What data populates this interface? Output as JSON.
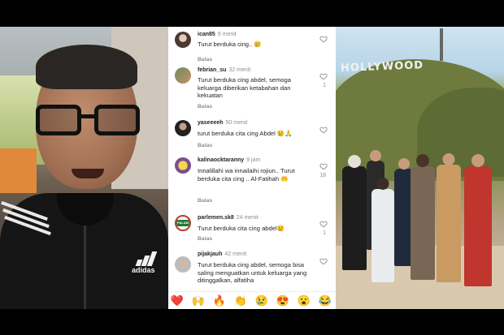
{
  "comments_panel": {
    "items": [
      {
        "username": "ican85",
        "time": "9 menit",
        "text": "Turut berduka cing.. 😢",
        "reply": "Balas",
        "likes": ""
      },
      {
        "username": "febrian_su",
        "time": "32 menit",
        "text": "Turut berduka cing abdel, semoga keluarga diberikan ketabahan dan kekuatan",
        "reply": "Balas",
        "likes": "1"
      },
      {
        "username": "yaseeeeh",
        "time": "50 menit",
        "text": "turut berduka cita cing Abdel 😢🙏",
        "reply": "Balas",
        "likes": ""
      },
      {
        "username": "kalinaocktaranny",
        "time": "9 jam",
        "text": "Innalillahi wa innailaihi rojiun.. Turut berduka cita cing .. Al-Fatihah 🤲",
        "reply": "Balas",
        "likes": "18"
      },
      {
        "username": "parlemen.sk8",
        "time": "24 menit",
        "text": "Turut berduka cita cing abdel😢",
        "reply": "Balas",
        "likes": "1"
      },
      {
        "username": "pijakjauh",
        "time": "42 menit",
        "text": "Turut berduka cing abdel, semoga bisa saling menguatkan untuk keluarga yang ditinggalkan, alfatiha",
        "reply": "",
        "likes": ""
      }
    ],
    "avatar_badge": "PALAM",
    "emoji_bar": [
      "❤️",
      "🙌",
      "🔥",
      "👏",
      "😢",
      "😍",
      "😮",
      "😂"
    ]
  },
  "left_video": {
    "brand_text": "adidas"
  },
  "right_photo": {
    "sign_text": "HOLLYWOOD"
  },
  "colors": {
    "username": "#262626",
    "muted": "#8e8e8e",
    "background": "#ffffff"
  },
  "icons": {
    "like": "heart-outline-icon"
  }
}
